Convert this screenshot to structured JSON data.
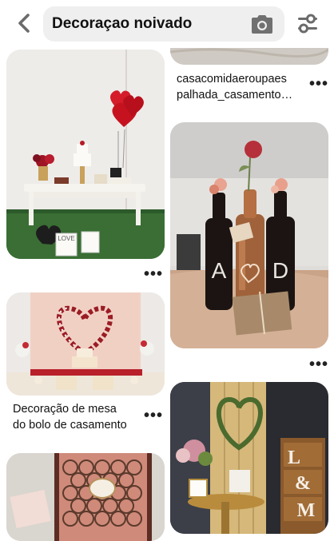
{
  "search": {
    "query": "Decoraçao noivado"
  },
  "icons": {
    "back": "chevron-left-icon",
    "camera": "camera-icon",
    "filter": "sliders-icon",
    "more": "more-dots-icon"
  },
  "pins": [
    {
      "title_line1": "casacomidaeroupaes",
      "title_line2": "palhada_casamento…"
    },
    {
      "title_line1": "",
      "title_line2": ""
    },
    {
      "title_line1": "",
      "title_line2": ""
    },
    {
      "title_line1": "Decoração de mesa",
      "title_line2": "do bolo de casamento"
    },
    {
      "title_line1": "",
      "title_line2": ""
    },
    {
      "title_line1": "",
      "title_line2": ""
    }
  ],
  "image_text": {
    "love_box": "LOVE",
    "bottle_left": "A",
    "bottle_right": "D",
    "shelf_letters": [
      "L",
      "&",
      "M"
    ]
  },
  "more_label": "•••",
  "colors": {
    "search_bg": "#efefef",
    "text": "#111111"
  }
}
